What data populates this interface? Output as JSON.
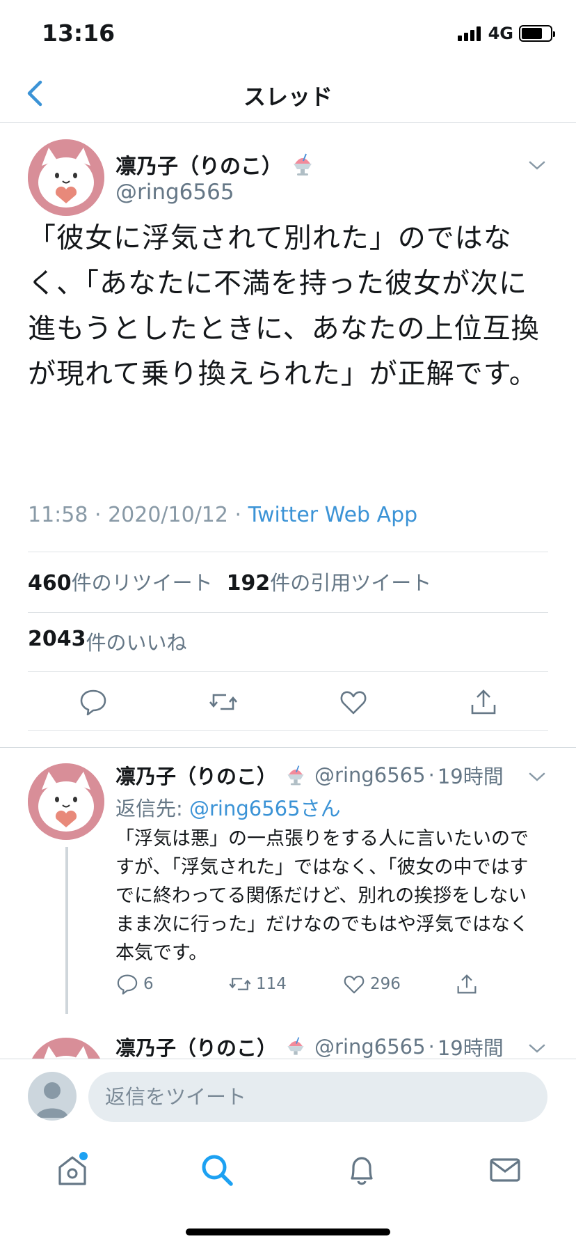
{
  "status_bar": {
    "time": "13:16",
    "network": "4G",
    "battery_level": 0.72
  },
  "nav": {
    "title": "スレッド"
  },
  "main_tweet": {
    "display_name": "凛乃子（りのこ）",
    "handle": "@ring6565",
    "text": "「彼女に浮気されて別れた」のではなく、「あなたに不満を持った彼女が次に進もうとしたときに、あなたの上位互換が現れて乗り換えられた」が正解です。",
    "time": "11:58 · 2020/10/12 · ",
    "via": "Twitter Web App",
    "retweet_count": "460",
    "retweet_label": "件のリツイート",
    "quote_count": "192",
    "quote_label": "件の引用ツイート",
    "like_count": "2043",
    "like_label": "件のいいね"
  },
  "reply_tweet": {
    "display_name": "凛乃子（りのこ）",
    "handle": "@ring6565",
    "time": "19時間",
    "reply_to_label": "返信先: ",
    "reply_to_handle": "@ring6565さん",
    "text": "「浮気は悪」の一点張りをする人に言いたいのですが、「浮気された」ではなく、「彼女の中ではすでに終わってる関係だけど、別れの挨拶をしないまま次に行った」だけなのでもはや浮気ではなく本気です。",
    "reply_count": "6",
    "retweet_count": "114",
    "like_count": "296"
  },
  "next_tweet": {
    "display_name": "凛乃子（りのこ）",
    "handle": "@ring6565",
    "time": "19時間"
  },
  "compose": {
    "placeholder": "返信をツイート"
  },
  "colors": {
    "accent": "#1da1f2",
    "link": "#3b93d6",
    "muted": "#657786"
  },
  "icons": [
    "back-chevron-icon",
    "shaved-ice-emoji-icon",
    "chevron-down-icon",
    "reply-icon",
    "retweet-icon",
    "like-icon",
    "share-icon",
    "home-icon",
    "search-icon",
    "notifications-icon",
    "messages-icon"
  ]
}
